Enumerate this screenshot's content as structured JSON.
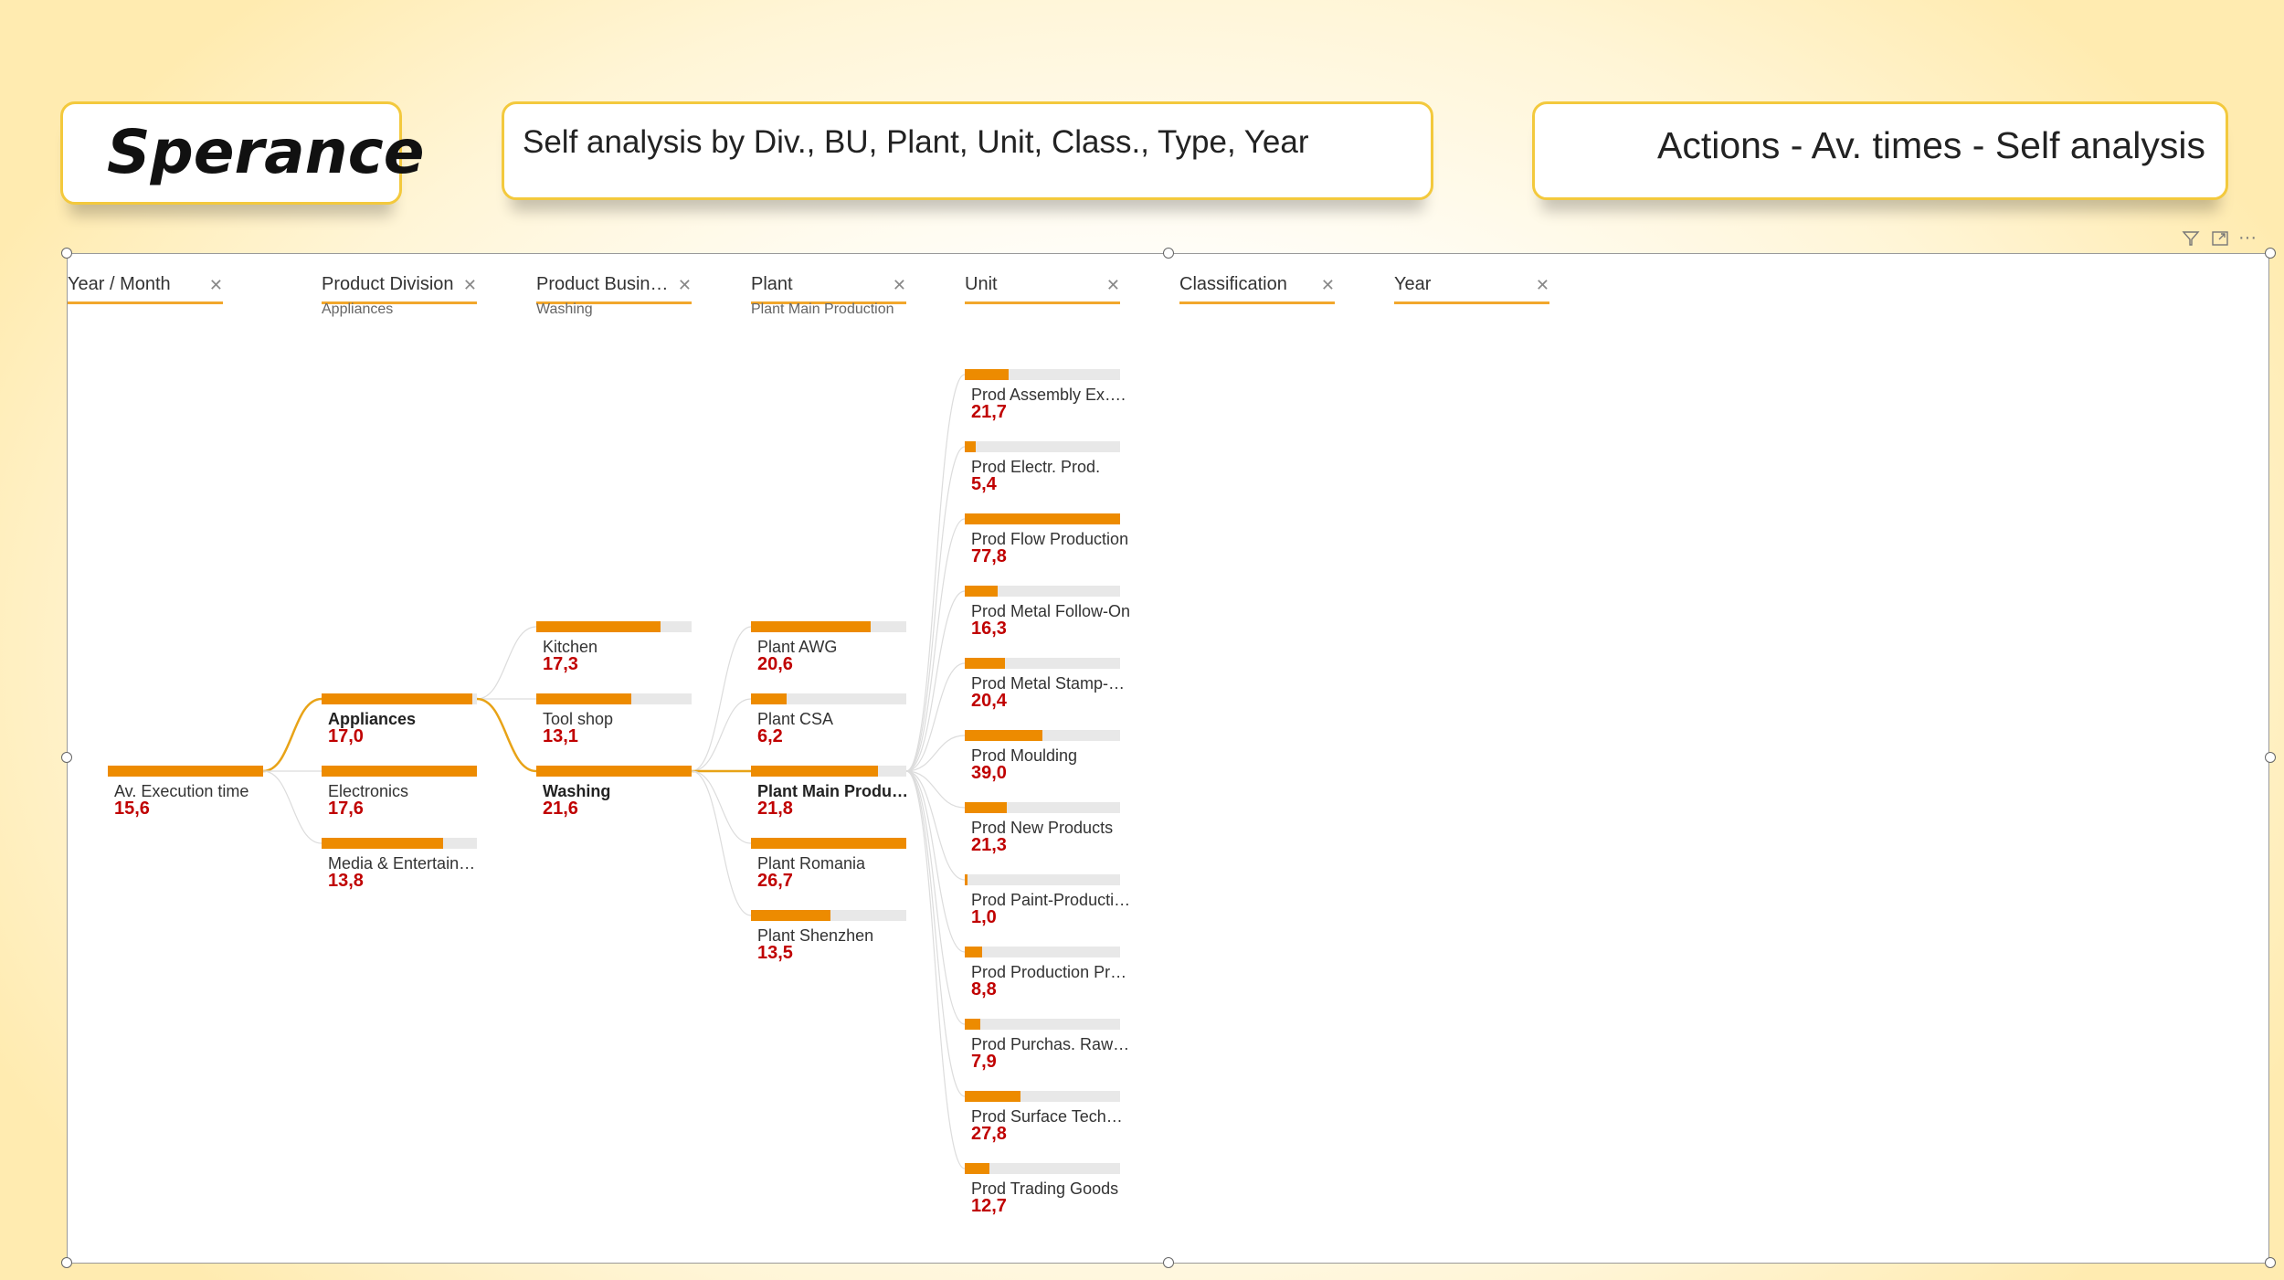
{
  "header": {
    "logo": "Sperance",
    "title": "Self analysis by Div., BU, Plant, Unit, Class., Type, Year",
    "actions_title": "Actions - Av. times - Self analysis"
  },
  "toolbar": {
    "filter_icon": "filter-icon",
    "focus_icon": "focus-mode-icon",
    "more_icon": "more-options-icon"
  },
  "levels": [
    {
      "name": "Product Division",
      "selected": "Appliances"
    },
    {
      "name": "Product Busine…",
      "selected": "Washing"
    },
    {
      "name": "Plant",
      "selected": "Plant Main Production"
    },
    {
      "name": "Unit",
      "selected": ""
    },
    {
      "name": "Classification",
      "selected": ""
    },
    {
      "name": "Year",
      "selected": ""
    },
    {
      "name": "Year / Month",
      "selected": ""
    }
  ],
  "root": {
    "label": "Av. Execution time",
    "value": "15,6",
    "fill": 1.0
  },
  "division": [
    {
      "label": "Appliances",
      "value": "17,0",
      "fill": 0.97,
      "selected": true
    },
    {
      "label": "Electronics",
      "value": "17,6",
      "fill": 1.0
    },
    {
      "label": "Media & Entertain…",
      "value": "13,8",
      "fill": 0.78
    }
  ],
  "business": [
    {
      "label": "Kitchen",
      "value": "17,3",
      "fill": 0.8
    },
    {
      "label": "Tool shop",
      "value": "13,1",
      "fill": 0.61
    },
    {
      "label": "Washing",
      "value": "21,6",
      "fill": 1.0,
      "selected": true
    }
  ],
  "plant": [
    {
      "label": "Plant AWG",
      "value": "20,6",
      "fill": 0.77
    },
    {
      "label": "Plant CSA",
      "value": "6,2",
      "fill": 0.23
    },
    {
      "label": "Plant Main Produc…",
      "value": "21,8",
      "fill": 0.82,
      "selected": true
    },
    {
      "label": "Plant Romania",
      "value": "26,7",
      "fill": 1.0
    },
    {
      "label": "Plant Shenzhen",
      "value": "13,5",
      "fill": 0.51
    }
  ],
  "unit": [
    {
      "label": "Prod Assembly Ex….",
      "value": "21,7",
      "fill": 0.28
    },
    {
      "label": "Prod Electr. Prod.",
      "value": "5,4",
      "fill": 0.07
    },
    {
      "label": "Prod Flow Production",
      "value": "77,8",
      "fill": 1.0
    },
    {
      "label": "Prod Metal Follow-On",
      "value": "16,3",
      "fill": 0.21
    },
    {
      "label": "Prod Metal Stamp-…",
      "value": "20,4",
      "fill": 0.26
    },
    {
      "label": "Prod Moulding",
      "value": "39,0",
      "fill": 0.5
    },
    {
      "label": "Prod New Products",
      "value": "21,3",
      "fill": 0.27
    },
    {
      "label": "Prod Paint-Producti…",
      "value": "1,0",
      "fill": 0.015
    },
    {
      "label": "Prod Production Pr…",
      "value": "8,8",
      "fill": 0.11
    },
    {
      "label": "Prod Purchas. Raw…",
      "value": "7,9",
      "fill": 0.1
    },
    {
      "label": "Prod Surface Tech…",
      "value": "27,8",
      "fill": 0.36
    },
    {
      "label": "Prod Trading Goods",
      "value": "12,7",
      "fill": 0.16
    }
  ]
}
